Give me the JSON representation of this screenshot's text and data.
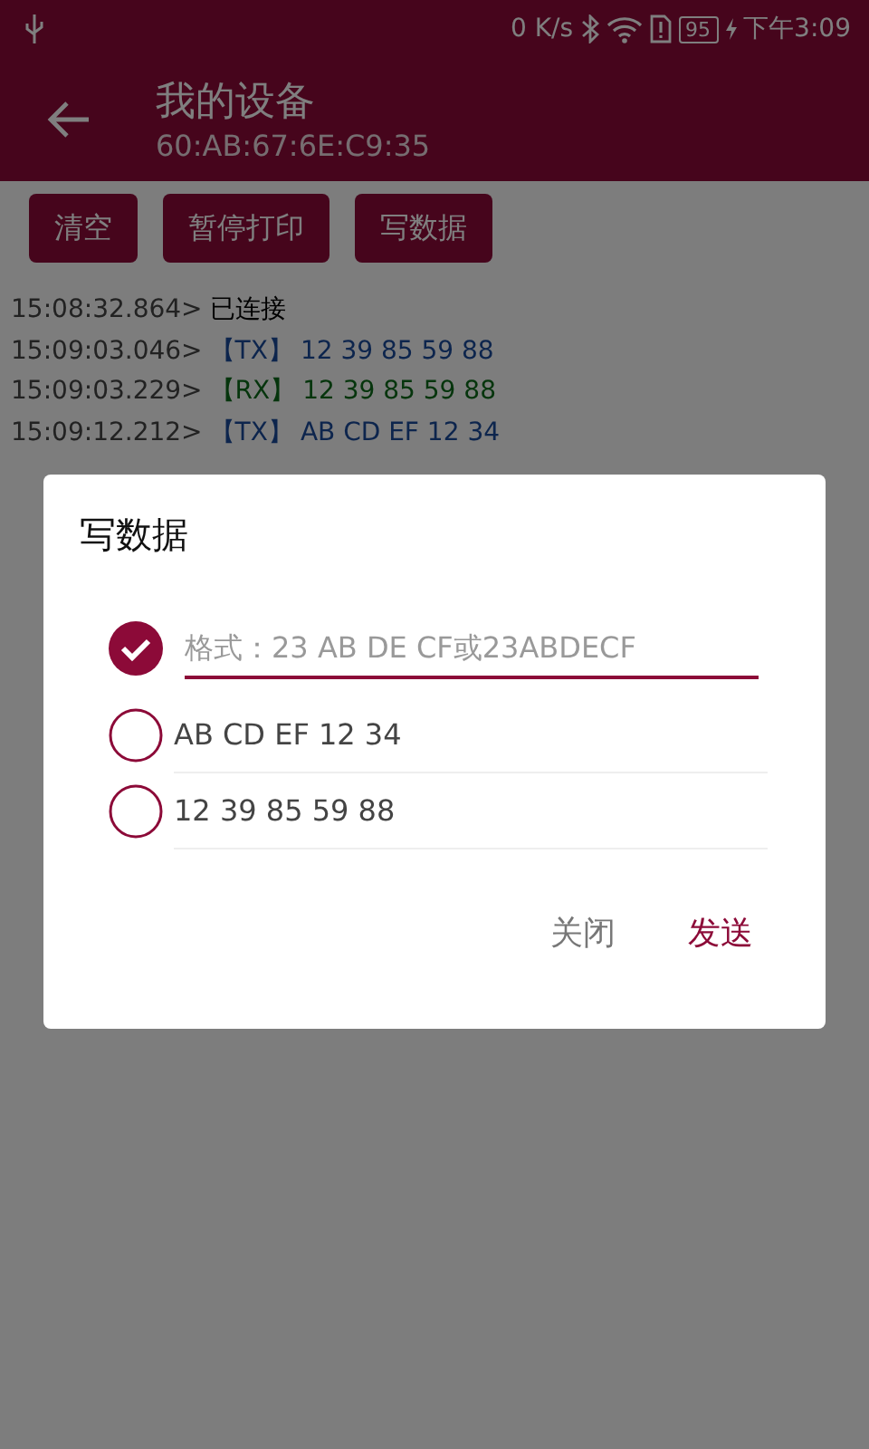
{
  "status_bar": {
    "network_speed": "0 K/s",
    "battery": "95",
    "time": "下午3:09"
  },
  "app_bar": {
    "title": "我的设备",
    "subtitle": "60:AB:67:6E:C9:35"
  },
  "toolbar_buttons": [
    "清空",
    "暂停打印",
    "写数据"
  ],
  "log": [
    {
      "time": "15:08:32.864>",
      "kind": "info",
      "text": "已连接"
    },
    {
      "time": "15:09:03.046>",
      "kind": "tx",
      "tag": "【TX】",
      "text": "12 39 85 59 88"
    },
    {
      "time": "15:09:03.229>",
      "kind": "rx",
      "tag": "【RX】",
      "text": "12 39 85 59 88"
    },
    {
      "time": "15:09:12.212>",
      "kind": "tx",
      "tag": "【TX】",
      "text": "AB CD EF 12 34"
    }
  ],
  "dialog": {
    "title": "写数据",
    "options": [
      {
        "kind": "input",
        "placeholder": "格式：23 AB DE CF或23ABDECF",
        "selected": true
      },
      {
        "kind": "text",
        "value": "AB CD EF 12 34",
        "selected": false
      },
      {
        "kind": "text",
        "value": "12 39 85 59 88",
        "selected": false
      }
    ],
    "actions": [
      {
        "label": "关闭",
        "primary": false
      },
      {
        "label": "发送",
        "primary": true
      }
    ]
  }
}
